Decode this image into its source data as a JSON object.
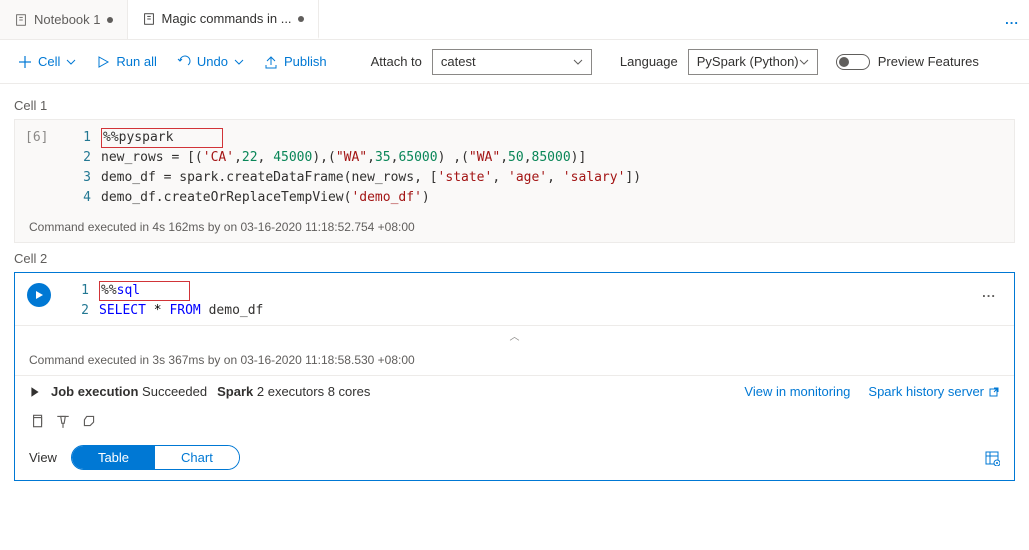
{
  "tabs": {
    "items": [
      {
        "label": "Notebook 1"
      },
      {
        "label": "Magic commands in ..."
      }
    ],
    "more": "..."
  },
  "toolbar": {
    "cell": "Cell",
    "run_all": "Run all",
    "undo": "Undo",
    "publish": "Publish",
    "attach_label": "Attach to",
    "attach_value": "catest",
    "language_label": "Language",
    "language_value": "PySpark (Python)",
    "preview": "Preview Features"
  },
  "cell1": {
    "label": "Cell 1",
    "exec_count": "[6]",
    "magic": "%%pyspark",
    "status": "Command executed in 4s 162ms by       on 03-16-2020 11:18:52.754 +08:00"
  },
  "cell2": {
    "label": "Cell 2",
    "magic": "%%sql",
    "more": "...",
    "collapse": "︿",
    "status": "Command executed in 3s 367ms by       on 03-16-2020 11:18:58.530 +08:00",
    "job_label": "Job execution",
    "job_status": "Succeeded",
    "spark_label": "Spark",
    "spark_detail": "2 executors 8 cores",
    "link_monitoring": "View in monitoring",
    "link_history": "Spark history server",
    "view_label": "View",
    "view_table": "Table",
    "view_chart": "Chart"
  }
}
